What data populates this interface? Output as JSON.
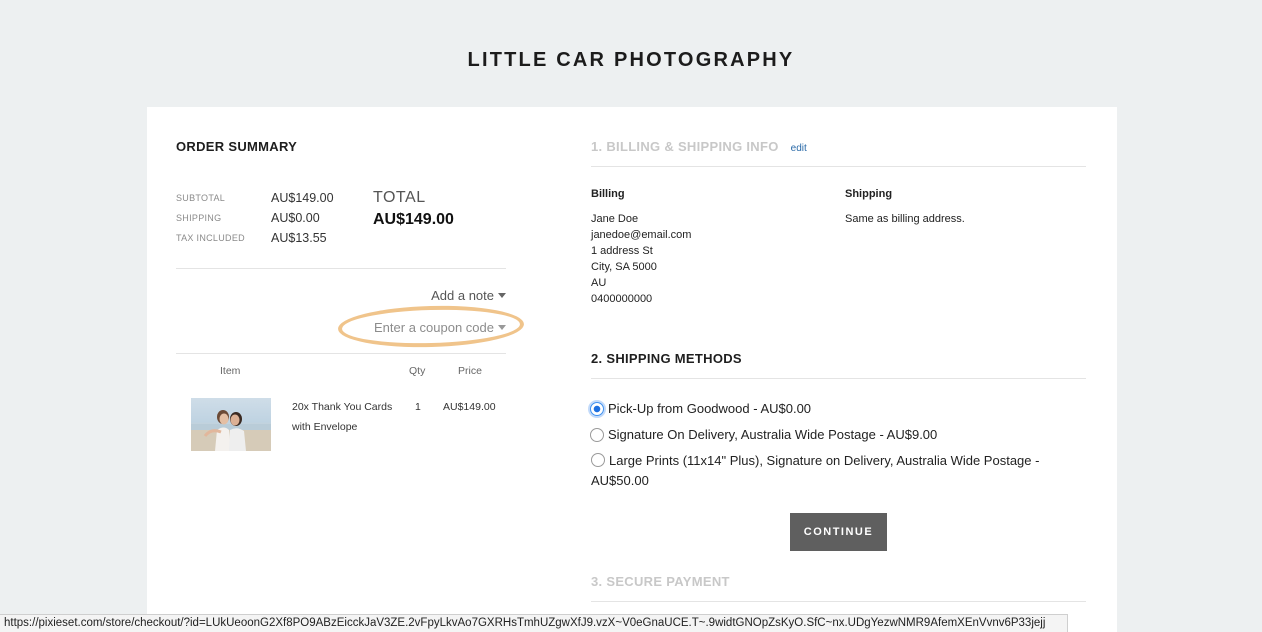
{
  "site": {
    "title": "LITTLE CAR PHOTOGRAPHY"
  },
  "order_summary": {
    "title": "ORDER SUMMARY",
    "rows": [
      {
        "label": "SUBTOTAL",
        "value": "AU$149.00"
      },
      {
        "label": "SHIPPING",
        "value": "AU$0.00"
      },
      {
        "label": "TAX INCLUDED",
        "value": "AU$13.55"
      }
    ],
    "total_label": "TOTAL",
    "total_value": "AU$149.00",
    "add_note_label": "Add a note",
    "coupon_label": "Enter a coupon code",
    "table_headers": {
      "item": "Item",
      "qty": "Qty",
      "price": "Price"
    },
    "items": [
      {
        "name": "20x Thank You Cards with Envelope",
        "qty": "1",
        "price": "AU$149.00"
      }
    ]
  },
  "billing_section": {
    "title": "1. BILLING & SHIPPING INFO",
    "edit_label": "edit",
    "billing_heading": "Billing",
    "billing_lines": [
      "Jane Doe",
      "janedoe@email.com",
      "1 address St",
      "City, SA 5000",
      "AU",
      "0400000000"
    ],
    "shipping_heading": "Shipping",
    "shipping_text": "Same as billing address."
  },
  "shipping_methods": {
    "title": "2. SHIPPING METHODS",
    "options": [
      {
        "label": "Pick-Up from Goodwood - AU$0.00",
        "selected": true
      },
      {
        "label": "Signature On Delivery, Australia Wide Postage - AU$9.00",
        "selected": false
      },
      {
        "label": "Large Prints (11x14\" Plus), Signature on Delivery, Australia Wide Postage - AU$50.00",
        "selected": false
      }
    ],
    "continue_label": "CONTINUE"
  },
  "payment_section": {
    "title": "3. SECURE PAYMENT"
  },
  "status_bar": {
    "url": "https://pixieset.com/store/checkout/?id=LUkUeoonG2Xf8PO9ABzEicckJaV3ZE.2vFpyLkvAo7GXRHsTmhUZgwXfJ9.vzX~V0eGnaUCE.T~.9widtGNOpZsKyO.SfC~nx.UDgYezwNMR9AfemXEnVvnv6P33jejj"
  },
  "colors": {
    "page_bg": "#edf0f1",
    "coupon_highlight": "#f0c48b",
    "link_blue": "#2a6aa8",
    "button_bg": "#5f5f5f",
    "muted_heading": "#c8c8c8"
  },
  "icons": {
    "dropdown": "caret-down-icon",
    "radio": "radio-button-icon"
  }
}
